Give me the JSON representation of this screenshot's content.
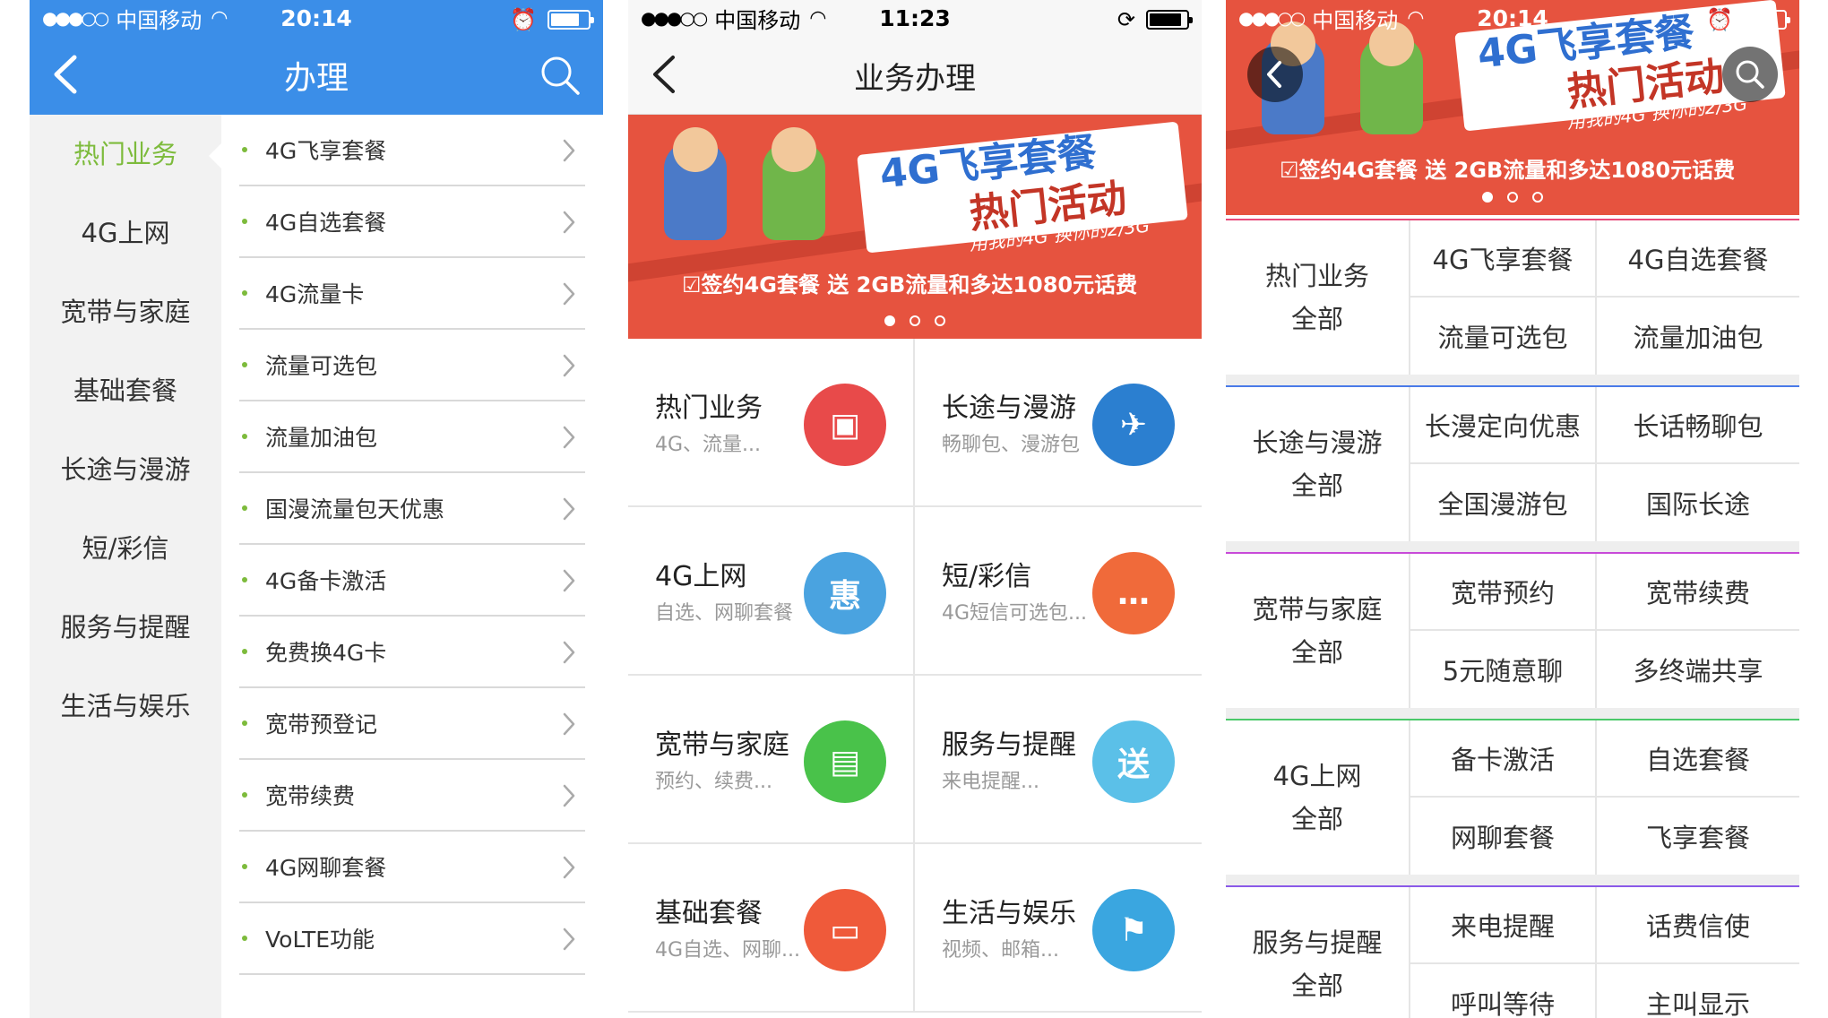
{
  "phone1": {
    "status": {
      "signal": "●●●○○",
      "carrier": "中国移动",
      "time": "20:14"
    },
    "title": "办理",
    "sidebar": [
      "热门业务",
      "4G上网",
      "宽带与家庭",
      "基础套餐",
      "长途与漫游",
      "短/彩信",
      "服务与提醒",
      "生活与娱乐"
    ],
    "items": [
      "4G飞享套餐",
      "4G自选套餐",
      "4G流量卡",
      "流量可选包",
      "流量加油包",
      "国漫流量包天优惠",
      "4G备卡激活",
      "免费换4G卡",
      "宽带预登记",
      "宽带续费",
      "4G网聊套餐",
      "VoLTE功能"
    ]
  },
  "phone2": {
    "status": {
      "signal": "●●●○○",
      "carrier": "中国移动",
      "time": "11:23"
    },
    "title": "业务办理",
    "banner": {
      "headline1": "4G飞享套餐",
      "headline2": "热门活动",
      "subline": "用我的4G 换你的2/3G",
      "footer": "☑签约4G套餐 送 2GB流量和多达1080元话费"
    },
    "cells": [
      {
        "title": "热门业务",
        "sub": "4G、流量...",
        "icon": "sim-card-icon",
        "color": "#e84a4a"
      },
      {
        "title": "长途与漫游",
        "sub": "畅聊包、漫游包",
        "icon": "globe-plane-icon",
        "color": "#2b7fd0"
      },
      {
        "title": "4G上网",
        "sub": "自选、网聊套餐",
        "icon": "rocket-discount-icon",
        "color": "#4aa3e0"
      },
      {
        "title": "短/彩信",
        "sub": "4G短信可选包...",
        "icon": "chat-bubble-icon",
        "color": "#f06a3a"
      },
      {
        "title": "宽带与家庭",
        "sub": "预约、续费...",
        "icon": "tv-shop-icon",
        "color": "#49c24a"
      },
      {
        "title": "服务与提醒",
        "sub": "来电提醒...",
        "icon": "gift-tag-icon",
        "color": "#5bc0e8"
      },
      {
        "title": "基础套餐",
        "sub": "4G自选、网聊...",
        "icon": "laptop-icon",
        "color": "#ef5a3a"
      },
      {
        "title": "生活与娱乐",
        "sub": "视频、邮箱...",
        "icon": "flag-2gb-icon",
        "color": "#3aa6e0"
      }
    ]
  },
  "phone3": {
    "status": {
      "signal": "●●●○○",
      "carrier": "中国移动",
      "time": "20:14"
    },
    "banner": {
      "headline1": "4G飞享套餐",
      "headline2": "热门活动",
      "subline": "用我的4G 换你的2/3G",
      "footer": "☑签约4G套餐 送 2GB流量和多达1080元话费"
    },
    "sections": [
      {
        "name": "热门业务",
        "all": "全部",
        "color": "#e84a7a",
        "items": [
          "4G飞享套餐",
          "4G自选套餐",
          "流量可选包",
          "流量加油包"
        ]
      },
      {
        "name": "长途与漫游",
        "all": "全部",
        "color": "#4a7ae8",
        "items": [
          "长漫定向优惠",
          "长话畅聊包",
          "全国漫游包",
          "国际长途"
        ]
      },
      {
        "name": "宽带与家庭",
        "all": "全部",
        "color": "#c84ad8",
        "items": [
          "宽带预约",
          "宽带续费",
          "5元随意聊",
          "多终端共享"
        ]
      },
      {
        "name": "4G上网",
        "all": "全部",
        "color": "#4ac86a",
        "items": [
          "备卡激活",
          "自选套餐",
          "网聊套餐",
          "飞享套餐"
        ]
      },
      {
        "name": "服务与提醒",
        "all": "全部",
        "color": "#8a5ae8",
        "items": [
          "来电提醒",
          "话费信使",
          "呼叫等待",
          "主叫显示"
        ]
      }
    ]
  }
}
